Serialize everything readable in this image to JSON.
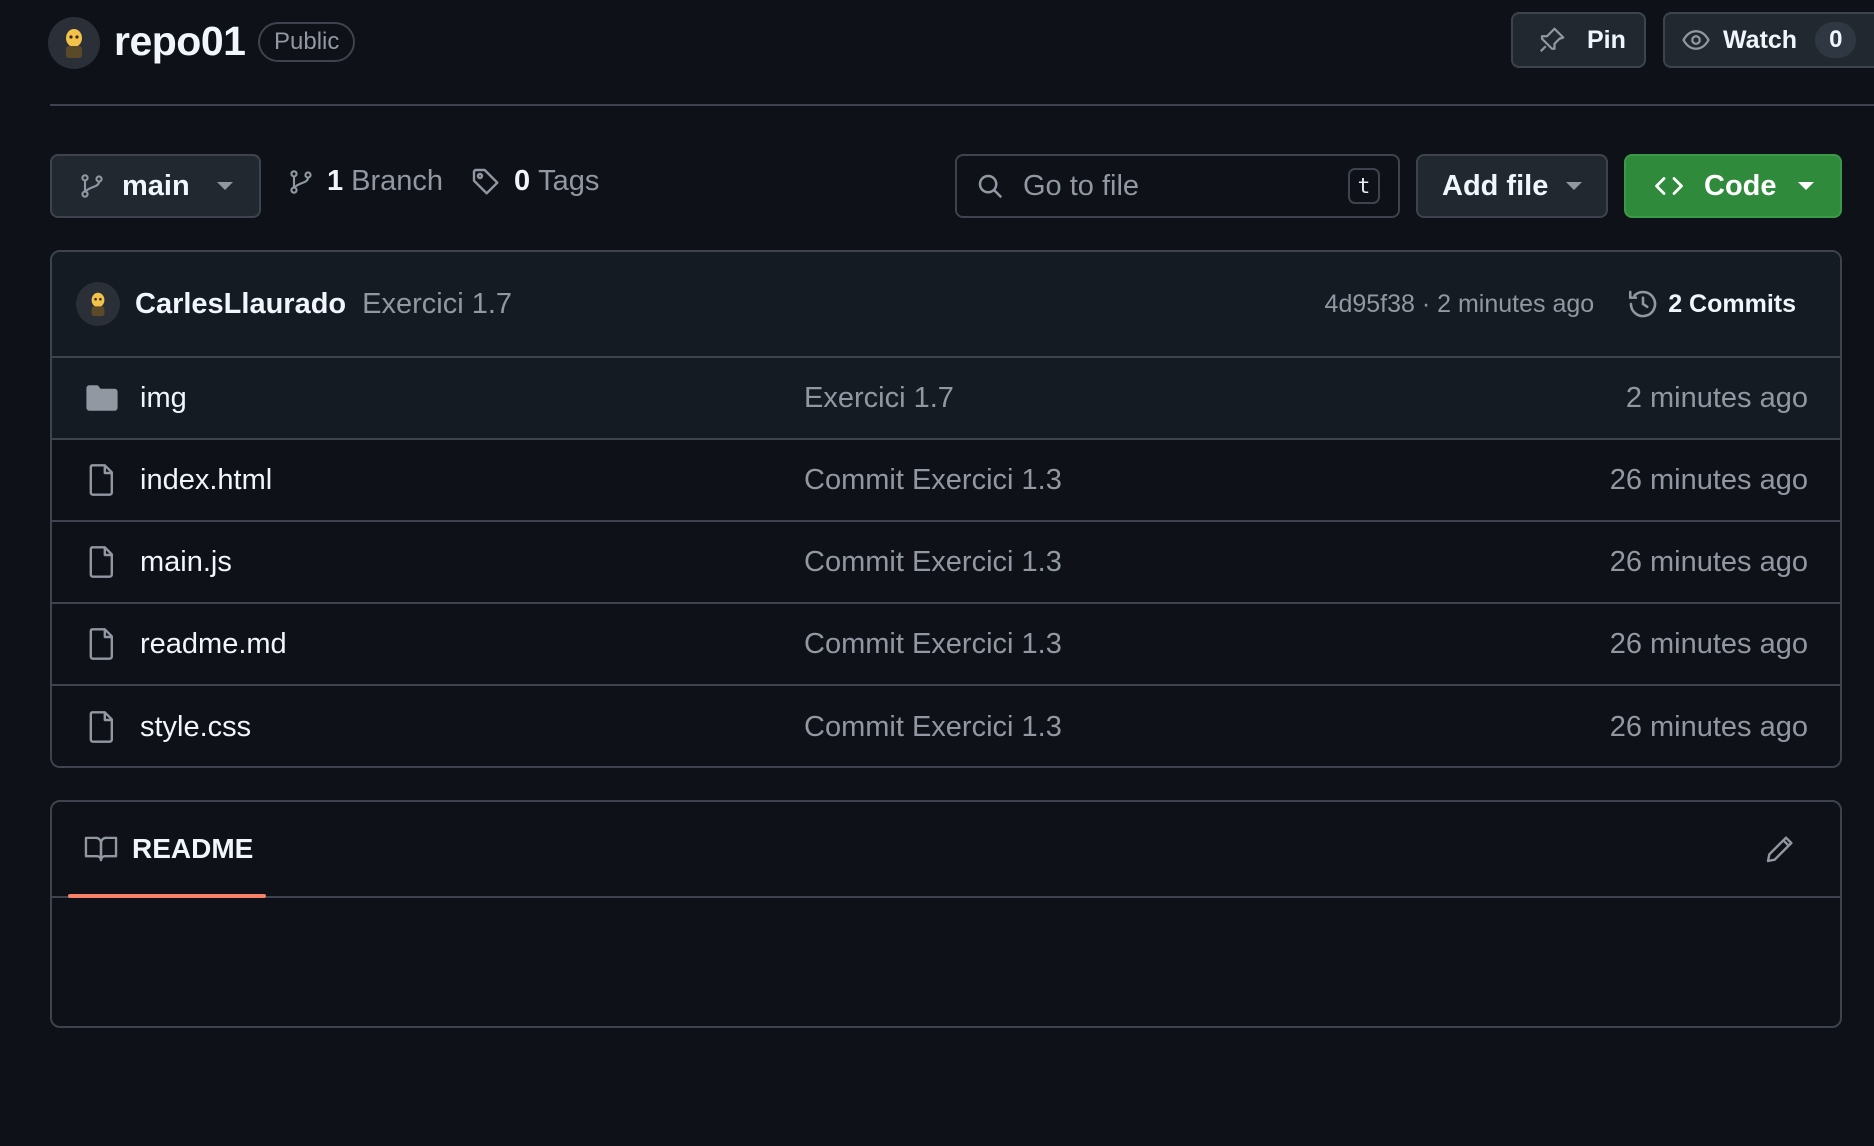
{
  "repo": {
    "name": "repo01",
    "visibility": "Public",
    "pin_label": "Pin",
    "watch_label": "Watch",
    "watch_count": "0"
  },
  "toolbar": {
    "branch": "main",
    "branch_count": "1",
    "branch_label": "Branch",
    "tag_count": "0",
    "tag_label": "Tags",
    "goto_placeholder": "Go to file",
    "goto_shortcut": "t",
    "add_file_label": "Add file",
    "code_label": "Code"
  },
  "latest_commit": {
    "author": "CarlesLlaurado",
    "message": "Exercici 1.7",
    "meta": "4d95f38 · 2 minutes ago",
    "commits_label": "2 Commits"
  },
  "files": [
    {
      "icon": "folder-icon",
      "name": "img",
      "message": "Exercici 1.7",
      "date": "2 minutes ago"
    },
    {
      "icon": "file-icon",
      "name": "index.html",
      "message": "Commit Exercici 1.3",
      "date": "26 minutes ago"
    },
    {
      "icon": "file-icon",
      "name": "main.js",
      "message": "Commit Exercici 1.3",
      "date": "26 minutes ago"
    },
    {
      "icon": "file-icon",
      "name": "readme.md",
      "message": "Commit Exercici 1.3",
      "date": "26 minutes ago"
    },
    {
      "icon": "file-icon",
      "name": "style.css",
      "message": "Commit Exercici 1.3",
      "date": "26 minutes ago"
    }
  ],
  "readme": {
    "tab_label": "README"
  },
  "colors": {
    "background": "#0e1117",
    "code_button": "#2f8a3c",
    "tab_underline": "#f78166"
  }
}
